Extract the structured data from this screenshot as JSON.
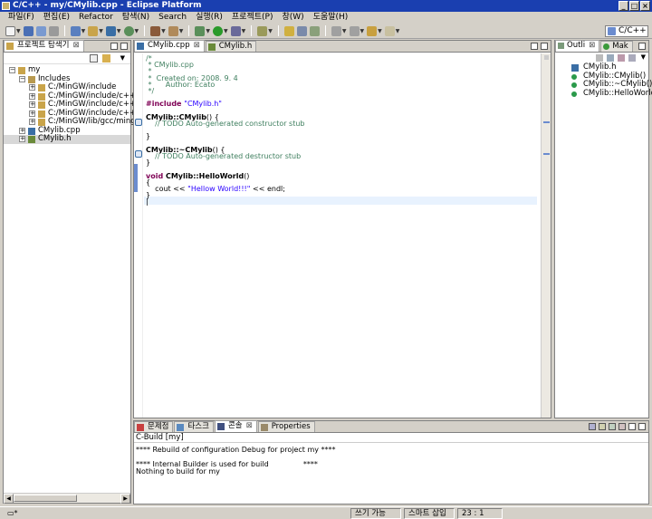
{
  "window": {
    "title": "C/C++ - my/CMylib.cpp - Eclipse Platform"
  },
  "menu": [
    "파일(F)",
    "편집(E)",
    "Refactor",
    "탐색(N)",
    "Search",
    "실행(R)",
    "프로젝트(P)",
    "창(W)",
    "도움말(H)"
  ],
  "perspective": {
    "label": "C/C++"
  },
  "explorer": {
    "tab_label": "프로젝트 탐색기",
    "tree": [
      {
        "label": "my",
        "level": 0,
        "expander": "−",
        "icon": "project-icon"
      },
      {
        "label": "Includes",
        "level": 1,
        "expander": "−",
        "icon": "includes-folder-icon"
      },
      {
        "label": "C:/MinGW/include",
        "level": 2,
        "expander": "+",
        "icon": "include-folder-icon"
      },
      {
        "label": "C:/MinGW/include/c++/3.4.5",
        "level": 2,
        "expander": "+",
        "icon": "include-folder-icon"
      },
      {
        "label": "C:/MinGW/include/c++/3.4.5",
        "level": 2,
        "expander": "+",
        "icon": "include-folder-icon"
      },
      {
        "label": "C:/MinGW/include/c++/3.4.5",
        "level": 2,
        "expander": "+",
        "icon": "include-folder-icon"
      },
      {
        "label": "C:/MinGW/lib/gcc/mingw32/",
        "level": 2,
        "expander": "+",
        "icon": "include-folder-icon"
      },
      {
        "label": "CMylib.cpp",
        "level": 1,
        "expander": "+",
        "icon": "cpp-file-icon"
      },
      {
        "label": "CMylib.h",
        "level": 1,
        "expander": "+",
        "icon": "header-file-icon"
      }
    ]
  },
  "editor": {
    "tabs": [
      {
        "label": "CMylib.cpp",
        "active": true
      },
      {
        "label": "CMylib.h",
        "active": false
      }
    ],
    "lines": [
      [
        {
          "t": "/*",
          "c": "cmt"
        }
      ],
      [
        {
          "t": " * CMylib.cpp",
          "c": "cmt"
        }
      ],
      [
        {
          "t": " *",
          "c": "cmt"
        }
      ],
      [
        {
          "t": " *  Created on: 2008. 9. 4",
          "c": "cmt"
        }
      ],
      [
        {
          "t": " *      Author: Ecato",
          "c": "cmt"
        }
      ],
      [
        {
          "t": " */",
          "c": "cmt"
        }
      ],
      [],
      [
        {
          "t": "#include ",
          "c": "kw"
        },
        {
          "t": "\"CMylib.h\"",
          "c": "str"
        }
      ],
      [],
      [
        {
          "t": "CMylib::CMylib",
          "c": "bold"
        },
        {
          "t": "() {",
          "c": ""
        }
      ],
      [
        {
          "t": "    // TODO Auto-generated constructor stub",
          "c": "cmt"
        }
      ],
      [],
      [
        {
          "t": "}",
          "c": ""
        }
      ],
      [],
      [
        {
          "t": "CMylib::~CMylib",
          "c": "bold"
        },
        {
          "t": "() {",
          "c": ""
        }
      ],
      [
        {
          "t": "    // TODO Auto-generated destructor stub",
          "c": "cmt"
        }
      ],
      [
        {
          "t": "}",
          "c": ""
        }
      ],
      [],
      [
        {
          "t": "void ",
          "c": "kw"
        },
        {
          "t": "CMylib::HelloWorld",
          "c": "bold"
        },
        {
          "t": "()",
          "c": ""
        }
      ],
      [
        {
          "t": "{",
          "c": ""
        }
      ],
      [
        {
          "t": "    cout << ",
          "c": ""
        },
        {
          "t": "\"Hellow World!!!\"",
          "c": "str"
        },
        {
          "t": " << endl;",
          "c": ""
        }
      ],
      [
        {
          "t": "}",
          "c": ""
        }
      ],
      [
        {
          "t": "|",
          "c": ""
        }
      ]
    ]
  },
  "outline": {
    "tabs": [
      {
        "label": "Outli"
      },
      {
        "label": "Mak"
      }
    ],
    "items": [
      {
        "label": "CMylib.h",
        "icon": "include-icon"
      },
      {
        "label": "CMylib::CMylib()",
        "icon": "method-icon"
      },
      {
        "label": "CMylib::~CMylib()",
        "icon": "method-icon"
      },
      {
        "label": "CMylib::HelloWorld() :",
        "icon": "method-icon"
      }
    ]
  },
  "console": {
    "tabs": [
      {
        "label": "문제점",
        "active": false
      },
      {
        "label": "타스크",
        "active": false
      },
      {
        "label": "콘솔",
        "active": true
      },
      {
        "label": "Properties",
        "active": false
      }
    ],
    "header": "C-Build [my]",
    "lines": [
      "**** Rebuild of configuration Debug for project my ****",
      "",
      "**** Internal Builder is used for build               ****",
      "Nothing to build for my"
    ]
  },
  "status": {
    "writable": "쓰기 가능",
    "insert_mode": "스마트 삽입",
    "position": "23 : 1"
  },
  "colors": {
    "title_bar": "#1a3fb0",
    "comment": "#3f7f5f",
    "keyword": "#7f0055",
    "string": "#2a00ff",
    "chrome": "#d4d0c8"
  }
}
